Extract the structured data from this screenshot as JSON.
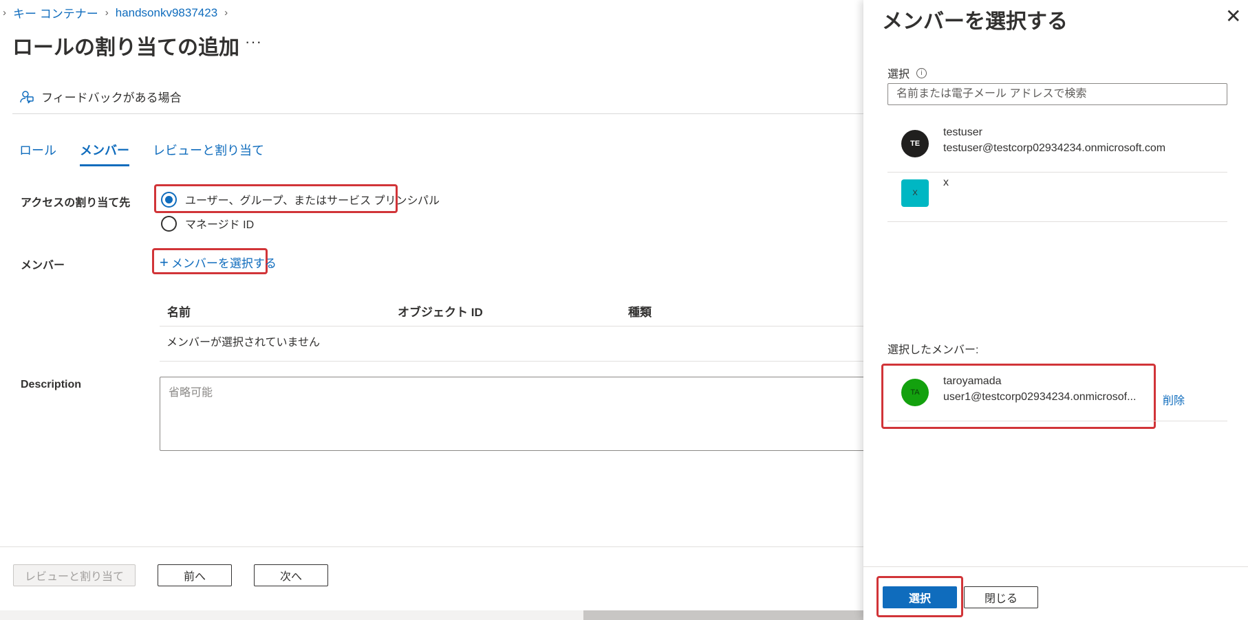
{
  "breadcrumb": {
    "items": [
      "キー コンテナー",
      "handsonkv9837423"
    ]
  },
  "page": {
    "title": "ロールの割り当ての追加",
    "more": "···"
  },
  "feedback": {
    "label": "フィードバックがある場合"
  },
  "tabs": [
    {
      "label": "ロール",
      "active": false
    },
    {
      "label": "メンバー",
      "active": true
    },
    {
      "label": "レビューと割り当て",
      "active": false
    }
  ],
  "form": {
    "access_label": "アクセスの割り当て先",
    "options": [
      {
        "label": "ユーザー、グループ、またはサービス プリンシパル",
        "selected": true
      },
      {
        "label": "マネージド ID",
        "selected": false
      }
    ],
    "members_label": "メンバー",
    "select_members_link": "メンバーを選択する",
    "table": {
      "columns": [
        "名前",
        "オブジェクト ID",
        "種類"
      ],
      "empty": "メンバーが選択されていません"
    },
    "description_label": "Description",
    "description_placeholder": "省略可能"
  },
  "footer": {
    "review": "レビューと割り当て",
    "prev": "前へ",
    "next": "次へ"
  },
  "panel": {
    "title": "メンバーを選択する",
    "select_label": "選択",
    "search_placeholder": "名前または電子メール アドレスで検索",
    "results": [
      {
        "initials": "TE",
        "name": "testuser",
        "email": "testuser@testcorp02934234.onmicrosoft.com",
        "color": "#201f1e"
      },
      {
        "initials": "X",
        "name": "x",
        "email": "",
        "color": "#00b7c3"
      }
    ],
    "selected_label": "選択したメンバー:",
    "selected": [
      {
        "initials": "TA",
        "name": "taroyamada",
        "email": "user1@testcorp02934234.onmicrosof...",
        "color": "#13a10e",
        "remove": "削除"
      }
    ],
    "select_button": "選択",
    "close_button": "閉じる"
  }
}
